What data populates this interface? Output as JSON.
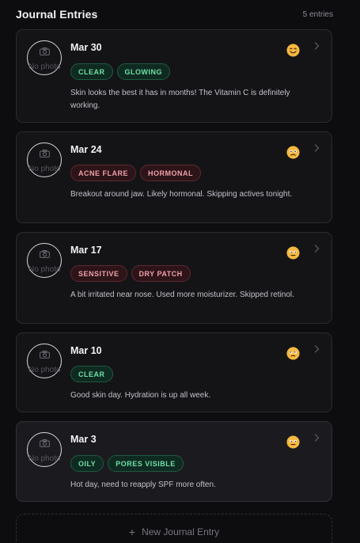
{
  "header": {
    "title": "Journal Entries",
    "count": "5 entries"
  },
  "no_photo_label": "No photo",
  "entries": [
    {
      "date": "Mar 30",
      "mood": "happy",
      "tags": [
        {
          "label": "CLEAR",
          "tone": "good"
        },
        {
          "label": "GLOWING",
          "tone": "good"
        }
      ],
      "note": "Skin looks the best it has in months! The Vitamin C is definitely working."
    },
    {
      "date": "Mar 24",
      "mood": "worried",
      "tags": [
        {
          "label": "ACNE FLARE",
          "tone": "bad"
        },
        {
          "label": "HORMONAL",
          "tone": "bad"
        }
      ],
      "note": "Breakout around jaw. Likely hormonal. Skipping actives tonight."
    },
    {
      "date": "Mar 17",
      "mood": "meh",
      "tags": [
        {
          "label": "SENSITIVE",
          "tone": "bad"
        },
        {
          "label": "DRY PATCH",
          "tone": "bad"
        }
      ],
      "note": "A bit irritated near nose. Used more moisturizer. Skipped retinol."
    },
    {
      "date": "Mar 10",
      "mood": "neutral",
      "tags": [
        {
          "label": "CLEAR",
          "tone": "good"
        }
      ],
      "note": "Good skin day. Hydration is up all week."
    },
    {
      "date": "Mar 3",
      "mood": "meh",
      "tags": [
        {
          "label": "OILY",
          "tone": "good"
        },
        {
          "label": "PORES VISIBLE",
          "tone": "good"
        }
      ],
      "note": "Hot day, need to reapply SPF more often."
    }
  ],
  "new_entry": {
    "icon": "plus-icon",
    "label": "New Journal Entry"
  },
  "colors": {
    "background": "#0d0d10",
    "card": "#141417",
    "good_tag": "#6ee0a8",
    "bad_tag": "#f0a0a8",
    "mood_face": "#f5b940"
  }
}
